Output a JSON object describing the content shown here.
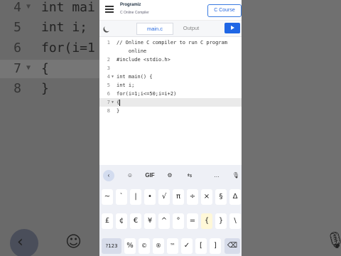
{
  "background": {
    "lines": [
      {
        "num": "4",
        "code": "int mai"
      },
      {
        "num": "5",
        "code": "int i;"
      },
      {
        "num": "6",
        "code": "for(i=1"
      },
      {
        "num": "7",
        "code": "{"
      },
      {
        "num": "8",
        "code": "}"
      }
    ]
  },
  "header": {
    "logo": "Programiz",
    "subtitle": "C Online Compiler",
    "language_button": "C Course"
  },
  "toolbar": {
    "tab_main": "main.c",
    "tab_output": "Output"
  },
  "editor": {
    "lines": [
      {
        "num": "1",
        "code": "// Online C compiler to run C program"
      },
      {
        "num": "",
        "code": "    online"
      },
      {
        "num": "2",
        "code": "#include <stdio.h>"
      },
      {
        "num": "3",
        "code": ""
      },
      {
        "num": "4",
        "code": "int main() {"
      },
      {
        "num": "5",
        "code": "int i;"
      },
      {
        "num": "6",
        "code": "for(i=1;i<=50;i=i+2)"
      },
      {
        "num": "7",
        "code": "{"
      },
      {
        "num": "8",
        "code": "}"
      }
    ]
  },
  "keyboard": {
    "toolbar": {
      "gif": "GIF",
      "more": "…"
    },
    "row1": [
      "~",
      "`",
      "|",
      "•",
      "√",
      "π",
      "÷",
      "×",
      "§",
      "Δ"
    ],
    "row2": [
      "£",
      "¢",
      "€",
      "¥",
      "^",
      "°",
      "=",
      "{",
      "}",
      "\\"
    ],
    "row3": [
      "?123",
      "%",
      "©",
      "®",
      "™",
      "✓",
      "[",
      "]"
    ]
  }
}
